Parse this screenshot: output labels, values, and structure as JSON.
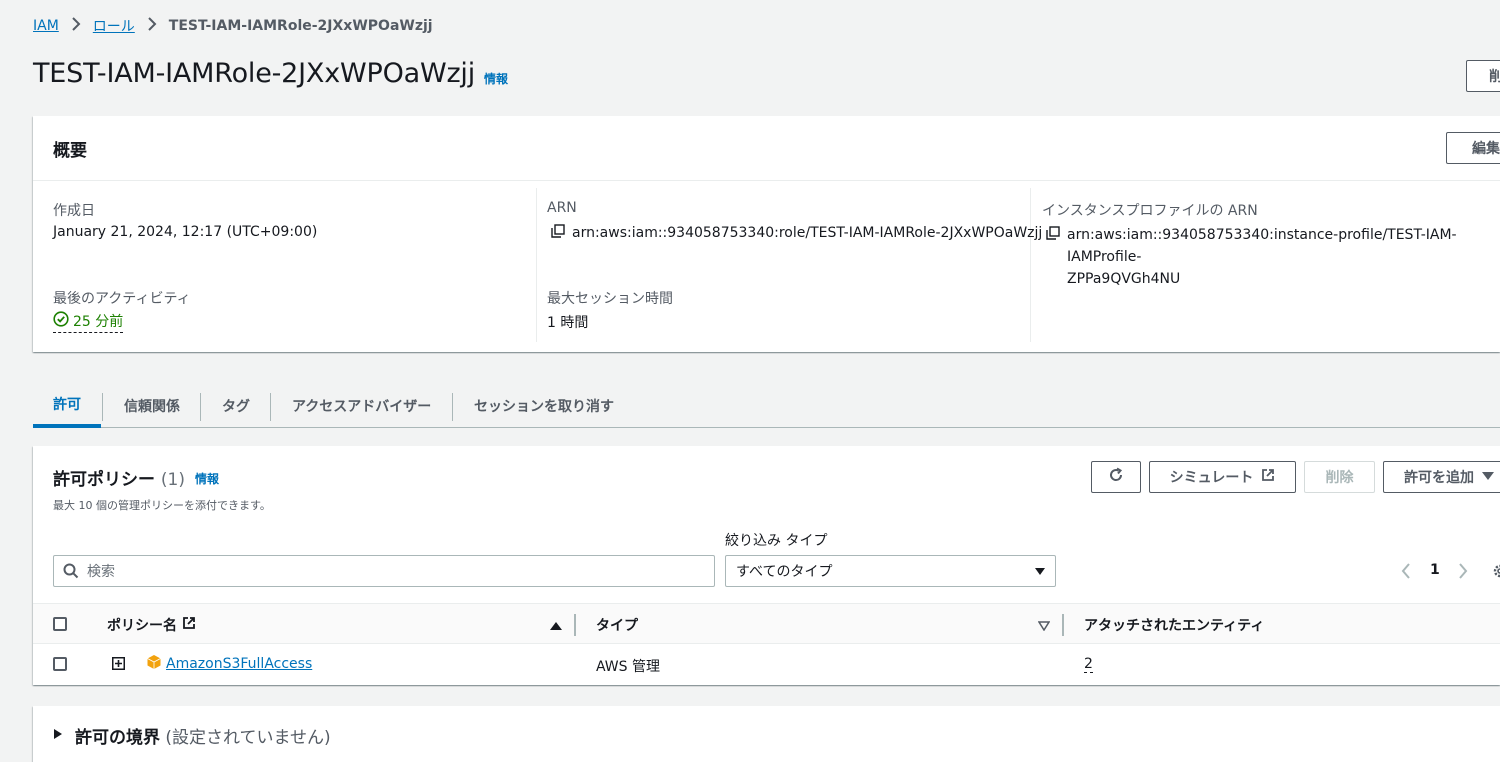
{
  "breadcrumb": {
    "items": [
      "IAM",
      "ロール"
    ],
    "current": "TEST-IAM-IAMRole-2JXxWPOaWzjj"
  },
  "page": {
    "title": "TEST-IAM-IAMRole-2JXxWPOaWzjj",
    "info": "情報",
    "delete_button": "削"
  },
  "summary": {
    "title": "概要",
    "edit_button": "編集",
    "created_label": "作成日",
    "created_value": "January 21, 2024, 12:17 (UTC+09:00)",
    "last_activity_label": "最後のアクティビティ",
    "last_activity_value": "25 分前",
    "arn_label": "ARN",
    "arn_value": "arn:aws:iam::934058753340:role/TEST-IAM-IAMRole-2JXxWPOaWzjj",
    "max_session_label": "最大セッション時間",
    "max_session_value": "1 時間",
    "instance_profile_label": "インスタンスプロファイルの ARN",
    "instance_profile_value_line1": "arn:aws:iam::934058753340:instance-profile/TEST-IAM-IAMProfile-",
    "instance_profile_value_line2": "ZPPa9QVGh4NU"
  },
  "tabs": [
    {
      "label": "許可",
      "active": true
    },
    {
      "label": "信頼関係",
      "active": false
    },
    {
      "label": "タグ",
      "active": false
    },
    {
      "label": "アクセスアドバイザー",
      "active": false
    },
    {
      "label": "セッションを取り消す",
      "active": false
    }
  ],
  "policies": {
    "title": "許可ポリシー",
    "count": "(1)",
    "info": "情報",
    "description": "最大 10 個の管理ポリシーを添付できます。",
    "simulate_button": "シミュレート",
    "remove_button": "削除",
    "add_button": "許可を追加",
    "filter_type_label": "絞り込み タイプ",
    "search_placeholder": "検索",
    "type_select_value": "すべてのタイプ",
    "page_number": "1",
    "columns": [
      "ポリシー名",
      "タイプ",
      "アタッチされたエンティティ"
    ],
    "rows": [
      {
        "name": "AmazonS3FullAccess",
        "type": "AWS 管理",
        "entities": "2"
      }
    ]
  },
  "boundary": {
    "title": "許可の境界",
    "status": "(設定されていません)"
  },
  "colors": {
    "link": "#0073bb",
    "success": "#1d8102",
    "background": "#f2f3f3"
  }
}
